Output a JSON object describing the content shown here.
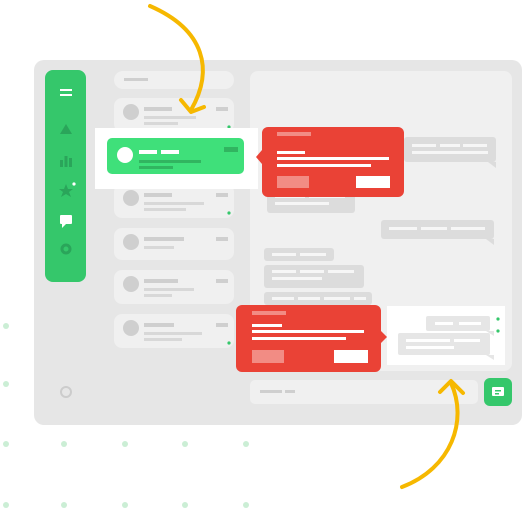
{
  "palette": {
    "window_bg": "#e6e6e6",
    "panel_bg": "#f0f0f0",
    "placeholder": "#cfcfcf",
    "sidebar_green": "#35c76b",
    "highlight_green": "#3fe07a",
    "alert_red": "#ea4236",
    "arrow_yellow": "#f6b800",
    "dot_green": "#cbeed5",
    "white": "#ffffff"
  },
  "icons": {
    "sidebar": [
      "menu-icon",
      "up-triangle-icon",
      "bar-chart-icon",
      "star-icon",
      "chat-icon",
      "circle-icon"
    ],
    "send": "send-icon",
    "settings": "circle-outline-icon"
  },
  "state": {
    "highlighted_conversation_index": 1,
    "popups": [
      "alert-popup-top",
      "alert-popup-bottom"
    ],
    "arrows": [
      "arrow-top",
      "arrow-bottom"
    ]
  }
}
